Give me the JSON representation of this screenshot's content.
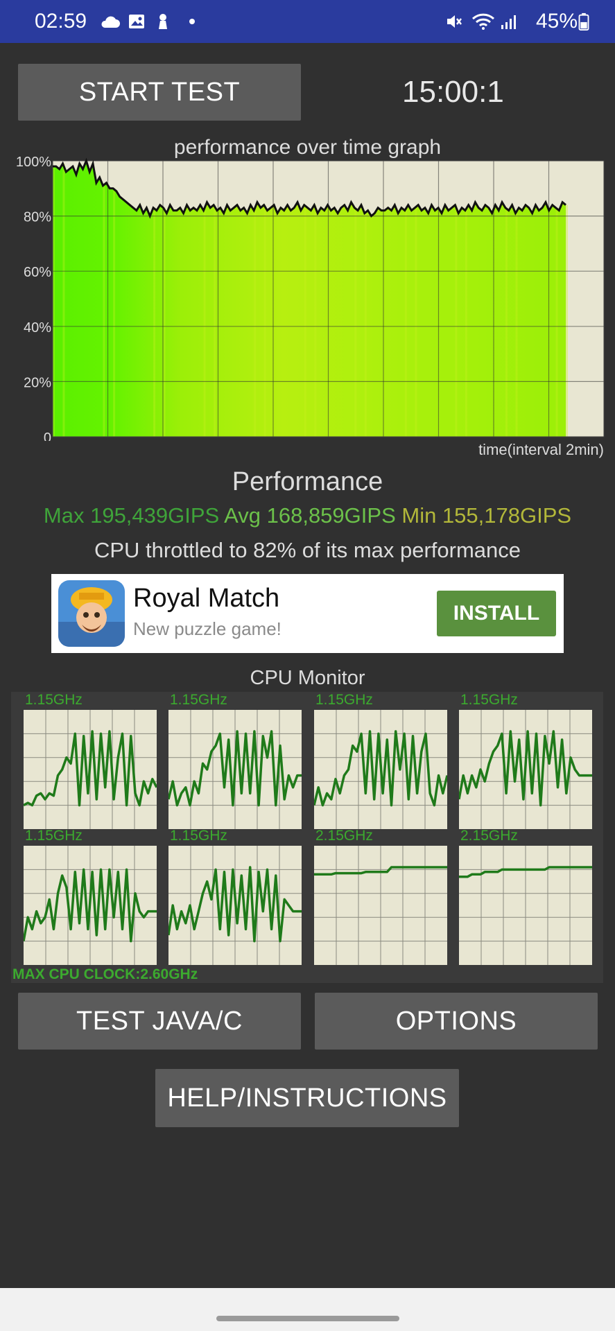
{
  "status_bar": {
    "time": "02:59",
    "battery": "45%",
    "icons": [
      "cloud-icon",
      "image-icon",
      "figure-icon",
      "dot-icon",
      "mute-icon",
      "wifi-icon",
      "signal-icon",
      "battery-icon"
    ]
  },
  "controls": {
    "start_label": "START TEST",
    "timer": "15:00:1",
    "test_java_label": "TEST JAVA/C",
    "options_label": "OPTIONS",
    "help_label": "HELP/INSTRUCTIONS"
  },
  "graph": {
    "title": "performance over time graph",
    "time_label": "time(interval 2min)",
    "y_ticks": [
      "100%",
      "80%",
      "60%",
      "40%",
      "20%",
      "0"
    ]
  },
  "chart_data": {
    "type": "line",
    "title": "performance over time graph",
    "xlabel": "time(interval 2min)",
    "ylabel": "",
    "ylim": [
      0,
      100
    ],
    "grid": true,
    "values": [
      98,
      98,
      97,
      99,
      96,
      97,
      98,
      95,
      99,
      97,
      100,
      96,
      99,
      92,
      94,
      91,
      92,
      90,
      90,
      89,
      87,
      86,
      85,
      84,
      83,
      82,
      84,
      81,
      83,
      80,
      83,
      82,
      84,
      83,
      81,
      84,
      82,
      82,
      83,
      81,
      84,
      82,
      83,
      82,
      84,
      82,
      85,
      83,
      84,
      82,
      83,
      81,
      84,
      82,
      83,
      84,
      82,
      83,
      81,
      84,
      82,
      85,
      83,
      84,
      82,
      83,
      84,
      81,
      83,
      82,
      84,
      82,
      83,
      85,
      82,
      84,
      83,
      82,
      84,
      81,
      83,
      82,
      84,
      82,
      83,
      81,
      83,
      84,
      82,
      85,
      83,
      82,
      84,
      81,
      82,
      80,
      81,
      83,
      82,
      82,
      83,
      82,
      84,
      81,
      83,
      82,
      84,
      82,
      83,
      84,
      82,
      83,
      81,
      84,
      82,
      83,
      81,
      84,
      82,
      83,
      84,
      81,
      83,
      82,
      84,
      82,
      85,
      83,
      82,
      84,
      83,
      81,
      84,
      82,
      85,
      83,
      82,
      84,
      81,
      83,
      82,
      84,
      83,
      81,
      84,
      82,
      83,
      85,
      82,
      84,
      83,
      82,
      85,
      84
    ]
  },
  "performance": {
    "heading": "Performance",
    "max": "Max 195,439GIPS",
    "avg": "Avg 168,859GIPS",
    "min": "Min 155,178GIPS",
    "throttle": "CPU throttled to 82% of its max performance"
  },
  "ad": {
    "title": "Royal Match",
    "subtitle": "New puzzle game!",
    "install_label": "INSTALL"
  },
  "cpu_monitor": {
    "title": "CPU Monitor",
    "max_clock": "MAX CPU CLOCK:2.60GHz",
    "cores": [
      {
        "label": "1.15GHz",
        "values": [
          0.2,
          0.22,
          0.2,
          0.28,
          0.3,
          0.25,
          0.3,
          0.28,
          0.45,
          0.5,
          0.6,
          0.55,
          0.8,
          0.2,
          0.78,
          0.3,
          0.82,
          0.25,
          0.8,
          0.35,
          0.82,
          0.25,
          0.6,
          0.8,
          0.2,
          0.78,
          0.3,
          0.2,
          0.4,
          0.3,
          0.42,
          0.35
        ]
      },
      {
        "label": "1.15GHz",
        "values": [
          0.25,
          0.4,
          0.2,
          0.3,
          0.35,
          0.2,
          0.4,
          0.3,
          0.55,
          0.5,
          0.65,
          0.7,
          0.8,
          0.35,
          0.75,
          0.2,
          0.82,
          0.3,
          0.8,
          0.3,
          0.82,
          0.2,
          0.78,
          0.6,
          0.82,
          0.2,
          0.7,
          0.25,
          0.45,
          0.35,
          0.45,
          0.45
        ]
      },
      {
        "label": "1.15GHz",
        "values": [
          0.2,
          0.35,
          0.2,
          0.3,
          0.25,
          0.42,
          0.3,
          0.45,
          0.5,
          0.7,
          0.65,
          0.8,
          0.3,
          0.82,
          0.25,
          0.8,
          0.3,
          0.75,
          0.2,
          0.82,
          0.5,
          0.8,
          0.25,
          0.78,
          0.3,
          0.65,
          0.8,
          0.3,
          0.2,
          0.45,
          0.3,
          0.45
        ]
      },
      {
        "label": "1.15GHz",
        "values": [
          0.25,
          0.45,
          0.3,
          0.45,
          0.35,
          0.5,
          0.4,
          0.55,
          0.65,
          0.7,
          0.8,
          0.3,
          0.82,
          0.4,
          0.75,
          0.25,
          0.82,
          0.3,
          0.8,
          0.2,
          0.78,
          0.55,
          0.82,
          0.35,
          0.75,
          0.3,
          0.6,
          0.5,
          0.45,
          0.45,
          0.45,
          0.45
        ]
      },
      {
        "label": "1.15GHz",
        "values": [
          0.2,
          0.4,
          0.3,
          0.45,
          0.35,
          0.4,
          0.55,
          0.3,
          0.6,
          0.75,
          0.65,
          0.3,
          0.78,
          0.35,
          0.8,
          0.3,
          0.78,
          0.25,
          0.8,
          0.3,
          0.8,
          0.4,
          0.78,
          0.3,
          0.8,
          0.2,
          0.6,
          0.45,
          0.4,
          0.45,
          0.45,
          0.45
        ]
      },
      {
        "label": "1.15GHz",
        "values": [
          0.25,
          0.5,
          0.3,
          0.45,
          0.35,
          0.5,
          0.3,
          0.45,
          0.6,
          0.7,
          0.55,
          0.8,
          0.3,
          0.78,
          0.25,
          0.8,
          0.35,
          0.75,
          0.3,
          0.82,
          0.2,
          0.78,
          0.45,
          0.8,
          0.3,
          0.75,
          0.2,
          0.55,
          0.5,
          0.45,
          0.45,
          0.45
        ]
      },
      {
        "label": "2.15GHz",
        "values": [
          0.76,
          0.76,
          0.76,
          0.76,
          0.76,
          0.77,
          0.77,
          0.77,
          0.77,
          0.77,
          0.77,
          0.77,
          0.78,
          0.78,
          0.78,
          0.78,
          0.78,
          0.78,
          0.82,
          0.82,
          0.82,
          0.82,
          0.82,
          0.82,
          0.82,
          0.82,
          0.82,
          0.82,
          0.82,
          0.82,
          0.82,
          0.82
        ]
      },
      {
        "label": "2.15GHz",
        "values": [
          0.74,
          0.74,
          0.74,
          0.76,
          0.76,
          0.76,
          0.78,
          0.78,
          0.78,
          0.78,
          0.8,
          0.8,
          0.8,
          0.8,
          0.8,
          0.8,
          0.8,
          0.8,
          0.8,
          0.8,
          0.8,
          0.82,
          0.82,
          0.82,
          0.82,
          0.82,
          0.82,
          0.82,
          0.82,
          0.82,
          0.82,
          0.82
        ]
      }
    ]
  }
}
